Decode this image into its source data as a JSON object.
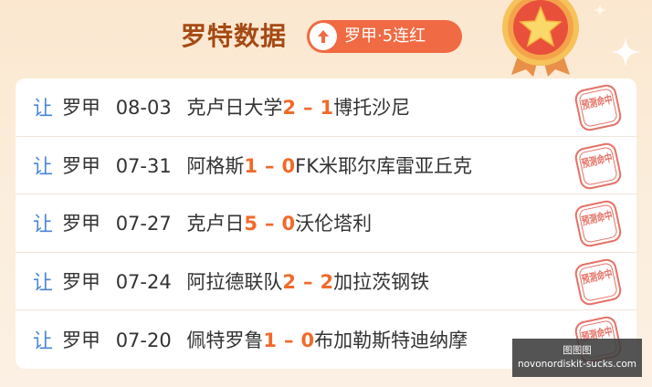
{
  "header": {
    "title": "罗特数据",
    "badge_text": "罗甲·5连红",
    "badge_icon": "up-arrow-icon",
    "medal_icon": "star-medal-icon"
  },
  "colors": {
    "title": "#a64a14",
    "badge_bg": "#f06a43",
    "score": "#f06a2a",
    "rang": "#4a86d6",
    "stamp": "#e05a4c"
  },
  "matches": [
    {
      "type": "让",
      "league": "罗甲",
      "date": "08-03",
      "home": "克卢日大学",
      "home_score": "2",
      "sep": "–",
      "away_score": "1",
      "away": "博托沙尼",
      "stamp": "预测命中"
    },
    {
      "type": "让",
      "league": "罗甲",
      "date": "07-31",
      "home": "阿格斯",
      "home_score": "1",
      "sep": "–",
      "away_score": "0",
      "away": "FK米耶尔库雷亚丘克",
      "stamp": "预测命中"
    },
    {
      "type": "让",
      "league": "罗甲",
      "date": "07-27",
      "home": "克卢日",
      "home_score": "5",
      "sep": "–",
      "away_score": "0",
      "away": "沃伦塔利",
      "stamp": "预测命中"
    },
    {
      "type": "让",
      "league": "罗甲",
      "date": "07-24",
      "home": "阿拉德联队",
      "home_score": "2",
      "sep": "–",
      "away_score": "2",
      "away": "加拉茨钢铁",
      "stamp": "预测命中"
    },
    {
      "type": "让",
      "league": "罗甲",
      "date": "07-20",
      "home": "佩特罗鲁",
      "home_score": "1",
      "sep": "–",
      "away_score": "0",
      "away": "布加勒斯特迪纳摩",
      "stamp": "预测命中"
    }
  ],
  "watermark": {
    "line1": "图图图",
    "line2": "novonordiskit-sucks.com"
  }
}
